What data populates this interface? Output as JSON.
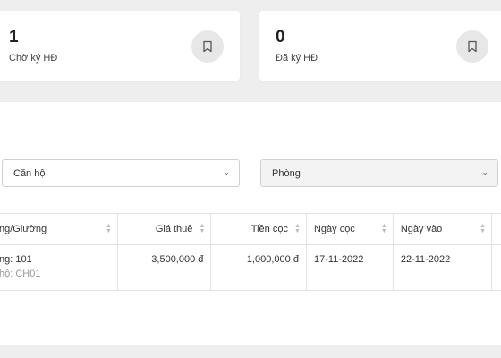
{
  "stats": [
    {
      "count": "1",
      "label": "Chờ ký HĐ",
      "icon": "bookmark-icon"
    },
    {
      "count": "0",
      "label": "Đã ký HĐ",
      "icon": "bookmark-icon"
    }
  ],
  "filters": {
    "apartment": {
      "value": "Căn hộ"
    },
    "room": {
      "value": "Phòng"
    }
  },
  "table": {
    "headers": [
      "ng/Giường",
      "Giá thuê",
      "Tiền cọc",
      "Ngày cọc",
      "Ngày vào"
    ],
    "rows": [
      {
        "room": "ng: 101",
        "apartment": "hộ: CH01",
        "rent": "3,500,000 đ",
        "deposit": "1,000,000 đ",
        "deposit_date": "17-11-2022",
        "move_in_date": "22-11-2022"
      }
    ]
  },
  "colors": {
    "background": "#eeeeee",
    "card": "#ffffff",
    "icon_bg": "#e7e7e7"
  }
}
